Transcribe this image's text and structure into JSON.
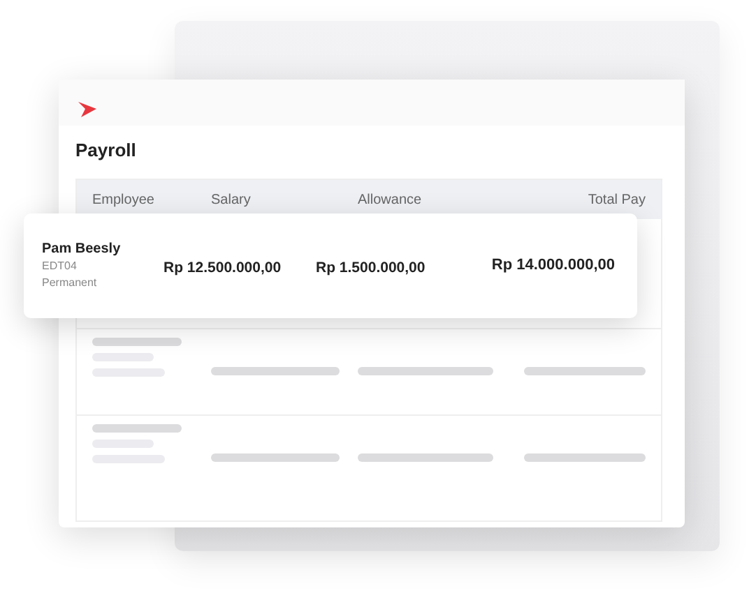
{
  "window": {
    "title": "Payroll"
  },
  "table": {
    "columns": [
      "Employee",
      "Salary",
      "Allowance",
      "Total Pay"
    ],
    "rows": [
      {
        "kind": "detail",
        "name": "Pam Beesly",
        "code": "EDT04",
        "status": "Permanent",
        "salary": "Rp 12.500.000,00",
        "allowance": "Rp 1.500.000,00",
        "total_pay": "Rp 14.000.000,00"
      },
      {
        "kind": "skeleton"
      },
      {
        "kind": "skeleton"
      }
    ]
  }
}
